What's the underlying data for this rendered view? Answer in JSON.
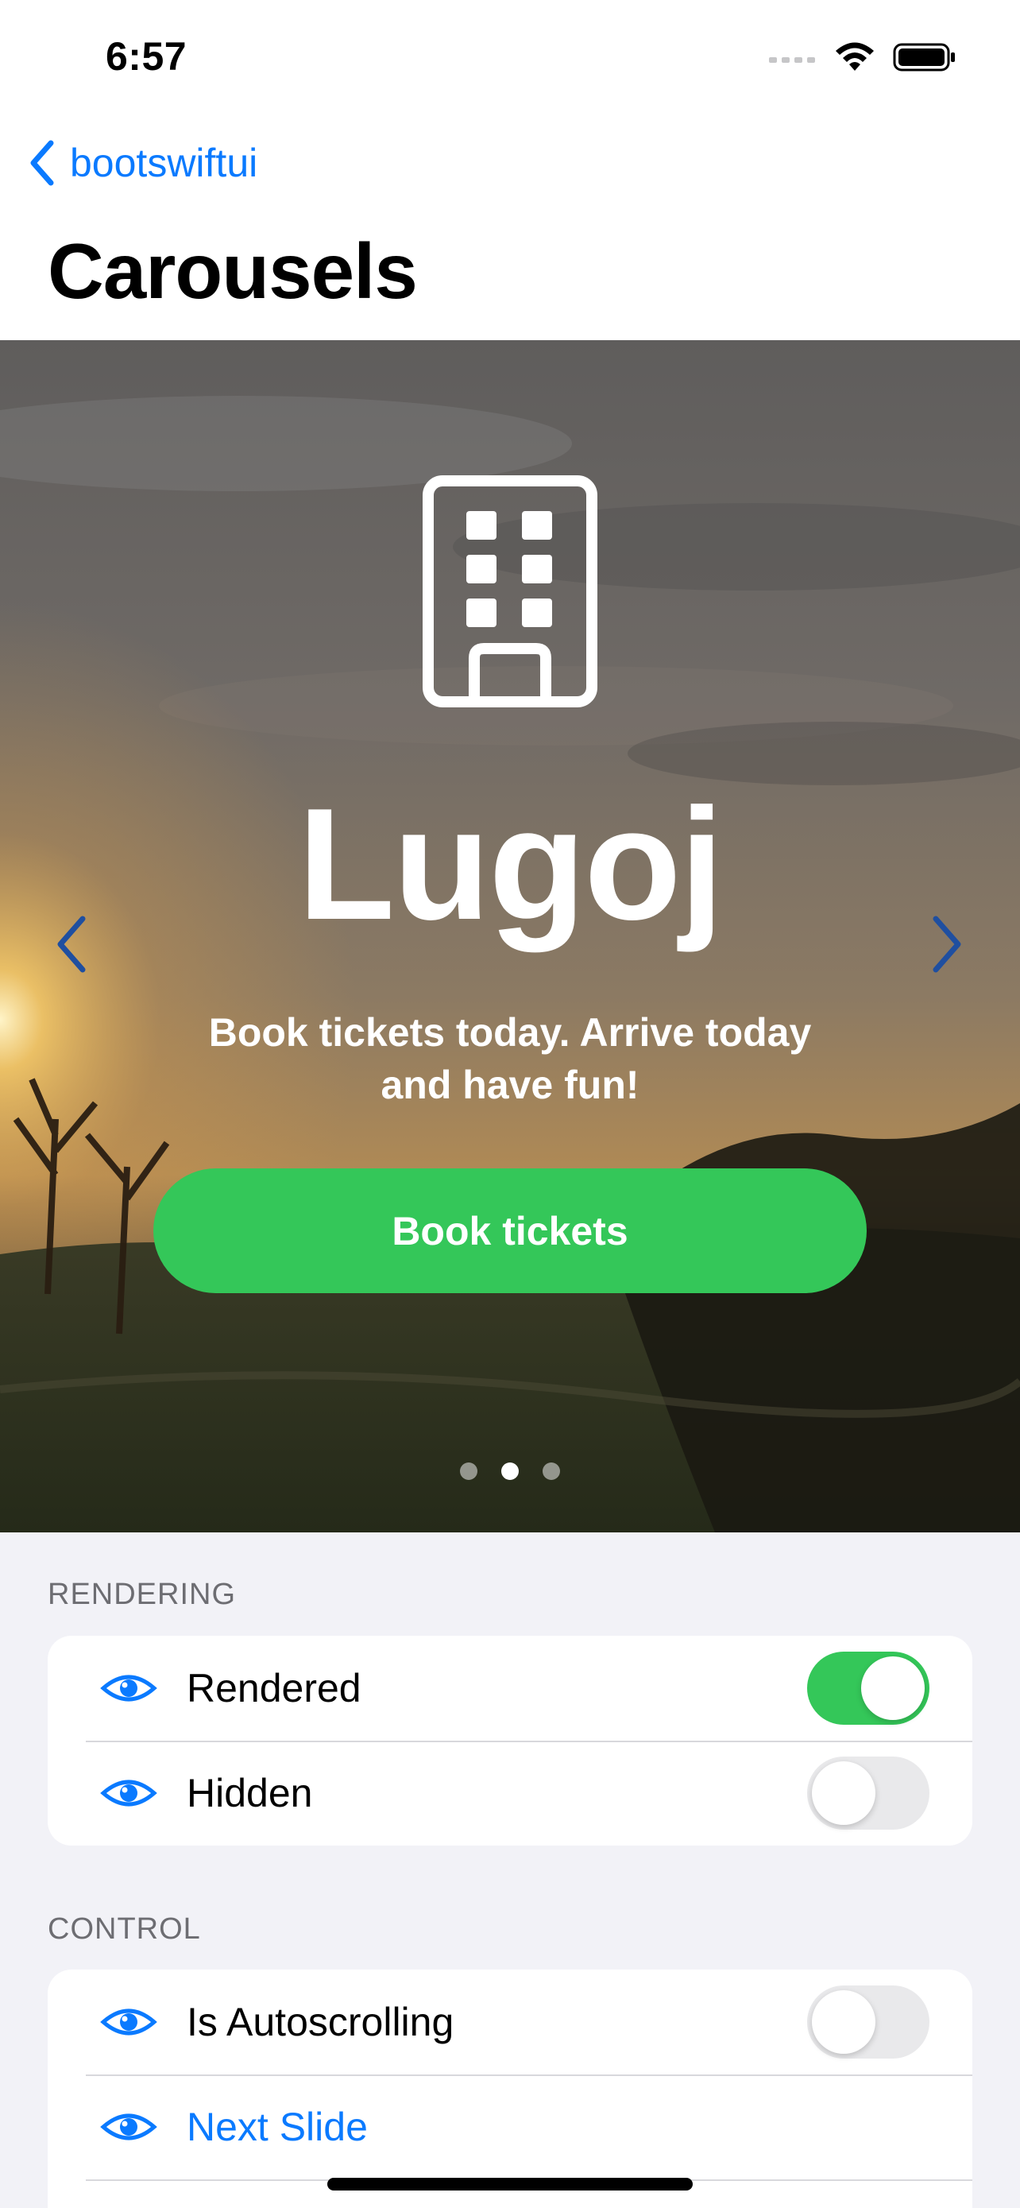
{
  "status_bar": {
    "time": "6:57"
  },
  "nav": {
    "back_label": "bootswiftui",
    "title": "Carousels"
  },
  "carousel": {
    "icon": "building-icon",
    "title": "Lugoj",
    "subtitle": "Book tickets today. Arrive today and have fun!",
    "button_label": "Book tickets",
    "page_count": 3,
    "current_page": 2
  },
  "sections": [
    {
      "header": "RENDERING",
      "rows": [
        {
          "label": "Rendered",
          "toggle": true
        },
        {
          "label": "Hidden",
          "toggle": false
        }
      ]
    },
    {
      "header": "CONTROL",
      "rows": [
        {
          "label": "Is Autoscrolling",
          "toggle": false
        },
        {
          "label": "Next Slide"
        }
      ]
    }
  ],
  "colors": {
    "accent": "#0A7AFF",
    "button_green": "#34C759",
    "background": "#F2F2F7"
  }
}
